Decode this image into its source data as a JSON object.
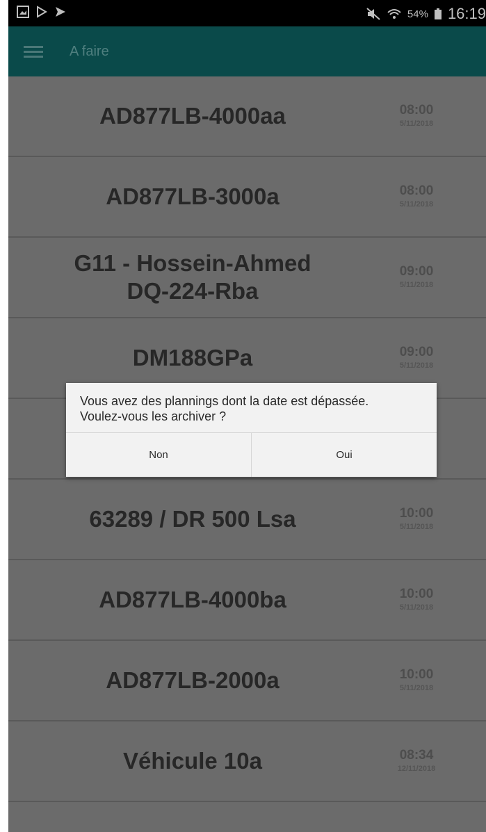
{
  "status_bar": {
    "left_icons": [
      "gallery-icon",
      "play-store-icon",
      "send-icon"
    ],
    "battery": "54%",
    "time": "16:19"
  },
  "app_bar": {
    "title": "A faire"
  },
  "list": [
    {
      "name": "AD877LB-4000aa",
      "time": "08:00",
      "date": "5/11/2018"
    },
    {
      "name": "AD877LB-3000a",
      "time": "08:00",
      "date": "5/11/2018"
    },
    {
      "name": "G11 - Hossein-Ahmed\nDQ-224-Rba",
      "time": "09:00",
      "date": "5/11/2018"
    },
    {
      "name": "DM188GPa",
      "time": "09:00",
      "date": "5/11/2018"
    },
    {
      "name": "",
      "time": "",
      "date": ""
    },
    {
      "name": "63289 / DR 500 Lsa",
      "time": "10:00",
      "date": "5/11/2018"
    },
    {
      "name": "AD877LB-4000ba",
      "time": "10:00",
      "date": "5/11/2018"
    },
    {
      "name": "AD877LB-2000a",
      "time": "10:00",
      "date": "5/11/2018"
    },
    {
      "name": "Véhicule 10a",
      "time": "08:34",
      "date": "12/11/2018"
    }
  ],
  "dialog": {
    "message": "Vous avez des plannings dont la date est dépassée.\nVoulez-vous les archiver ?",
    "no_label": "Non",
    "yes_label": "Oui"
  },
  "colors": {
    "app_bar": "#0a4a4a",
    "list_background": "#6b6b6b",
    "dialog_background": "#f2f2f2"
  }
}
